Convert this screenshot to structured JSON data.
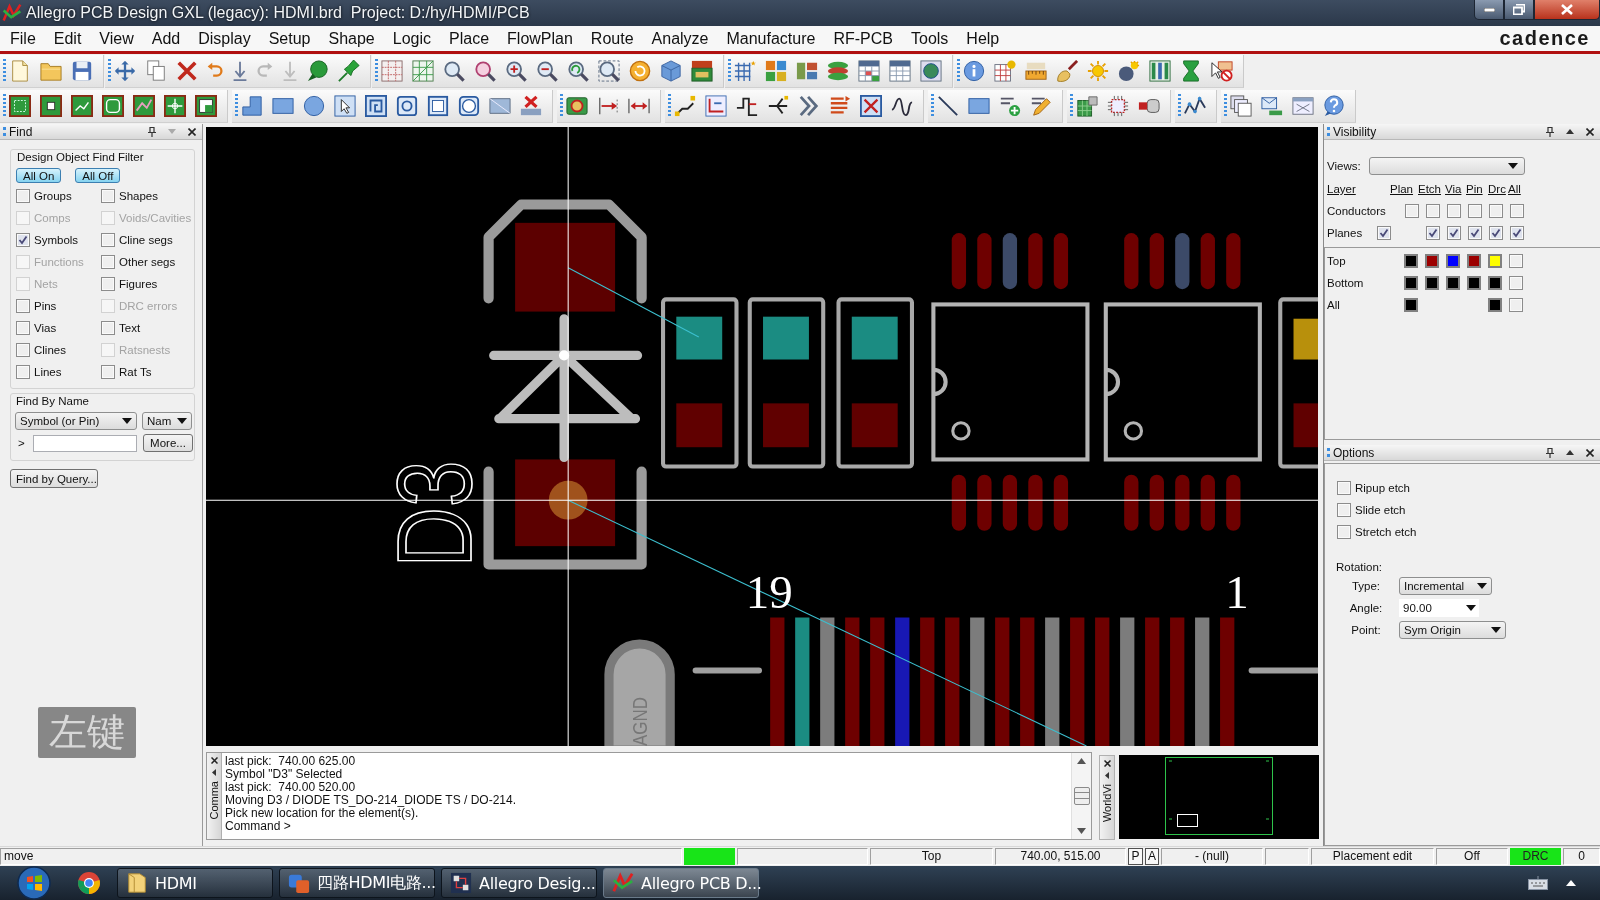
{
  "window": {
    "title": "Allegro PCB Design GXL (legacy): HDMI.brd  Project: D:/hy/HDMI/PCB"
  },
  "menu_bar": {
    "items": [
      "File",
      "Edit",
      "View",
      "Add",
      "Display",
      "Setup",
      "Shape",
      "Logic",
      "Place",
      "FlowPlan",
      "Route",
      "Analyze",
      "Manufacture",
      "RF-PCB",
      "Tools",
      "Help"
    ],
    "logo": "cadence"
  },
  "find_panel": {
    "title": "Find",
    "filter_title": "Design Object Find Filter",
    "buttons": [
      "All On",
      "All Off"
    ],
    "options": [
      {
        "label": "Groups",
        "checked": false,
        "disabled": false
      },
      {
        "label": "Shapes",
        "checked": false,
        "disabled": false
      },
      {
        "label": "Comps",
        "checked": false,
        "disabled": true
      },
      {
        "label": "Voids/Cavities",
        "checked": false,
        "disabled": true
      },
      {
        "label": "Symbols",
        "checked": true,
        "disabled": false
      },
      {
        "label": "Cline segs",
        "checked": false,
        "disabled": false
      },
      {
        "label": "Functions",
        "checked": false,
        "disabled": true
      },
      {
        "label": "Other segs",
        "checked": false,
        "disabled": false
      },
      {
        "label": "Nets",
        "checked": false,
        "disabled": true
      },
      {
        "label": "Figures",
        "checked": false,
        "disabled": false
      },
      {
        "label": "Pins",
        "checked": false,
        "disabled": false
      },
      {
        "label": "DRC errors",
        "checked": false,
        "disabled": true
      },
      {
        "label": "Vias",
        "checked": false,
        "disabled": false
      },
      {
        "label": "Text",
        "checked": false,
        "disabled": false
      },
      {
        "label": "Clines",
        "checked": false,
        "disabled": false
      },
      {
        "label": "Ratsnests",
        "checked": false,
        "disabled": true
      },
      {
        "label": "Lines",
        "checked": false,
        "disabled": false
      },
      {
        "label": "Rat Ts",
        "checked": false,
        "disabled": false
      }
    ],
    "find_by_name": {
      "title": "Find By Name",
      "object_type": "Symbol (or Pin)",
      "match": "Nam",
      "prompt": ">",
      "more_button": "More..."
    },
    "query_button": "Find by Query..."
  },
  "key_overlay": "左键",
  "canvas": {
    "refdes": "D3",
    "pin_labels": [
      "19",
      "1"
    ],
    "net_label": "AGND"
  },
  "command_window": {
    "tab": "Comma",
    "lines": [
      "last pick:  740.00 625.00",
      "Symbol \"D3\" Selected",
      "last pick:  740.00 520.00",
      "Moving D3 / DIODE TS_DO-214_DIODE TS / DO-214.",
      "Pick new location for the element(s).",
      "Command >"
    ]
  },
  "world_view": {
    "tab": "WorldVi"
  },
  "visibility_panel": {
    "title": "Visibility",
    "views_label": "Views:",
    "columns": [
      "Layer",
      "Plan",
      "Etch",
      "Via",
      "Pin",
      "Drc",
      "All"
    ],
    "groups": [
      {
        "label": "Conductors",
        "cells": [
          {
            "kind": "checkbox",
            "checked": false
          },
          {
            "kind": "checkbox",
            "checked": false
          },
          {
            "kind": "checkbox",
            "checked": false
          },
          {
            "kind": "checkbox",
            "checked": false
          },
          {
            "kind": "checkbox",
            "checked": false
          },
          {
            "kind": "checkbox",
            "checked": false
          }
        ]
      },
      {
        "label": "Planes",
        "master": {
          "checked": true
        },
        "cells": [
          {
            "kind": "blank"
          },
          {
            "kind": "checkbox",
            "checked": true
          },
          {
            "kind": "checkbox",
            "checked": true
          },
          {
            "kind": "checkbox",
            "checked": true
          },
          {
            "kind": "checkbox",
            "checked": true
          },
          {
            "kind": "checkbox",
            "checked": true
          }
        ]
      }
    ],
    "layers": [
      {
        "label": "Top",
        "cells": [
          {
            "kind": "swatch",
            "color": "#000000"
          },
          {
            "kind": "swatch",
            "color": "#9c0000"
          },
          {
            "kind": "swatch",
            "color": "#0000ff"
          },
          {
            "kind": "swatch",
            "color": "#9c0000"
          },
          {
            "kind": "swatch",
            "color": "#ffff00"
          },
          {
            "kind": "checkbox",
            "checked": false
          }
        ]
      },
      {
        "label": "Bottom",
        "cells": [
          {
            "kind": "swatch",
            "color": "#000000"
          },
          {
            "kind": "swatch",
            "color": "#000000"
          },
          {
            "kind": "swatch",
            "color": "#000000"
          },
          {
            "kind": "swatch",
            "color": "#000000"
          },
          {
            "kind": "swatch",
            "color": "#000000"
          },
          {
            "kind": "checkbox",
            "checked": false
          }
        ]
      },
      {
        "label": "All",
        "cells": [
          {
            "kind": "swatch",
            "color": "#000000"
          },
          {
            "kind": "blank"
          },
          {
            "kind": "blank"
          },
          {
            "kind": "blank"
          },
          {
            "kind": "swatch",
            "color": "#000000"
          },
          {
            "kind": "checkbox",
            "checked": false
          }
        ]
      }
    ]
  },
  "options_panel": {
    "title": "Options",
    "checks": [
      {
        "label": "Ripup etch",
        "checked": false
      },
      {
        "label": "Slide etch",
        "checked": false
      },
      {
        "label": "Stretch etch",
        "checked": false
      }
    ],
    "rotation_title": "Rotation:",
    "fields": [
      {
        "label": "Type:",
        "value": "Incremental",
        "kind": "dropdown"
      },
      {
        "label": "Angle:",
        "value": "90.00",
        "kind": "combo"
      },
      {
        "label": "Point:",
        "value": "Sym Origin",
        "kind": "dropdown"
      }
    ]
  },
  "status_bar": {
    "cells": [
      {
        "kind": "text",
        "text": "move"
      },
      {
        "kind": "indicator",
        "on": true
      },
      {
        "kind": "blank"
      },
      {
        "kind": "text",
        "text": "Top"
      },
      {
        "kind": "text",
        "text": "740.00, 515.00"
      },
      {
        "kind": "toggle",
        "text": "P"
      },
      {
        "kind": "toggle",
        "text": "A"
      },
      {
        "kind": "text",
        "text": "- (null)"
      },
      {
        "kind": "blank"
      },
      {
        "kind": "text",
        "text": "Placement edit"
      },
      {
        "kind": "text",
        "text": "Off"
      },
      {
        "kind": "indicator",
        "text": "DRC",
        "on": true
      },
      {
        "kind": "text",
        "text": "0"
      }
    ]
  },
  "taskbar": {
    "apps": [
      {
        "label": "HDMI",
        "kind": "folder",
        "selected": false
      },
      {
        "label": "四路HDMI电路...",
        "kind": "slides",
        "selected": false
      },
      {
        "label": "Allegro Desig...",
        "kind": "design",
        "selected": false
      },
      {
        "label": "Allegro PCB D...",
        "kind": "pcb",
        "selected": true
      }
    ]
  }
}
